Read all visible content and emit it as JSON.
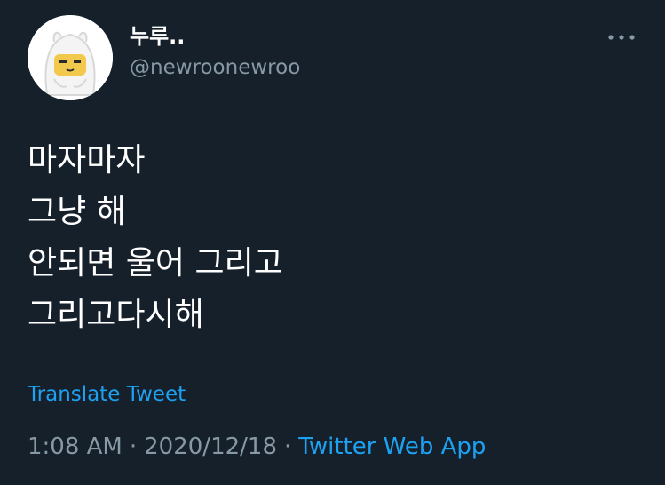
{
  "author": {
    "display_name": "누루..",
    "handle": "@newroonewroo",
    "avatar_icon": "cartoon-avatar-icon"
  },
  "tweet": {
    "lines": [
      "마자마자",
      "그냥 해",
      "안되면 울어 그리고",
      "그리고다시해"
    ],
    "translate_label": "Translate Tweet"
  },
  "meta": {
    "time": "1:08 AM",
    "separator": "·",
    "date": "2020/12/18",
    "source": "Twitter Web App"
  },
  "more_icon": "more-horizontal-icon",
  "colors": {
    "background": "#15202b",
    "text": "#ffffff",
    "secondary": "#8899a6",
    "accent": "#1da1f2",
    "divider": "#38444d"
  }
}
